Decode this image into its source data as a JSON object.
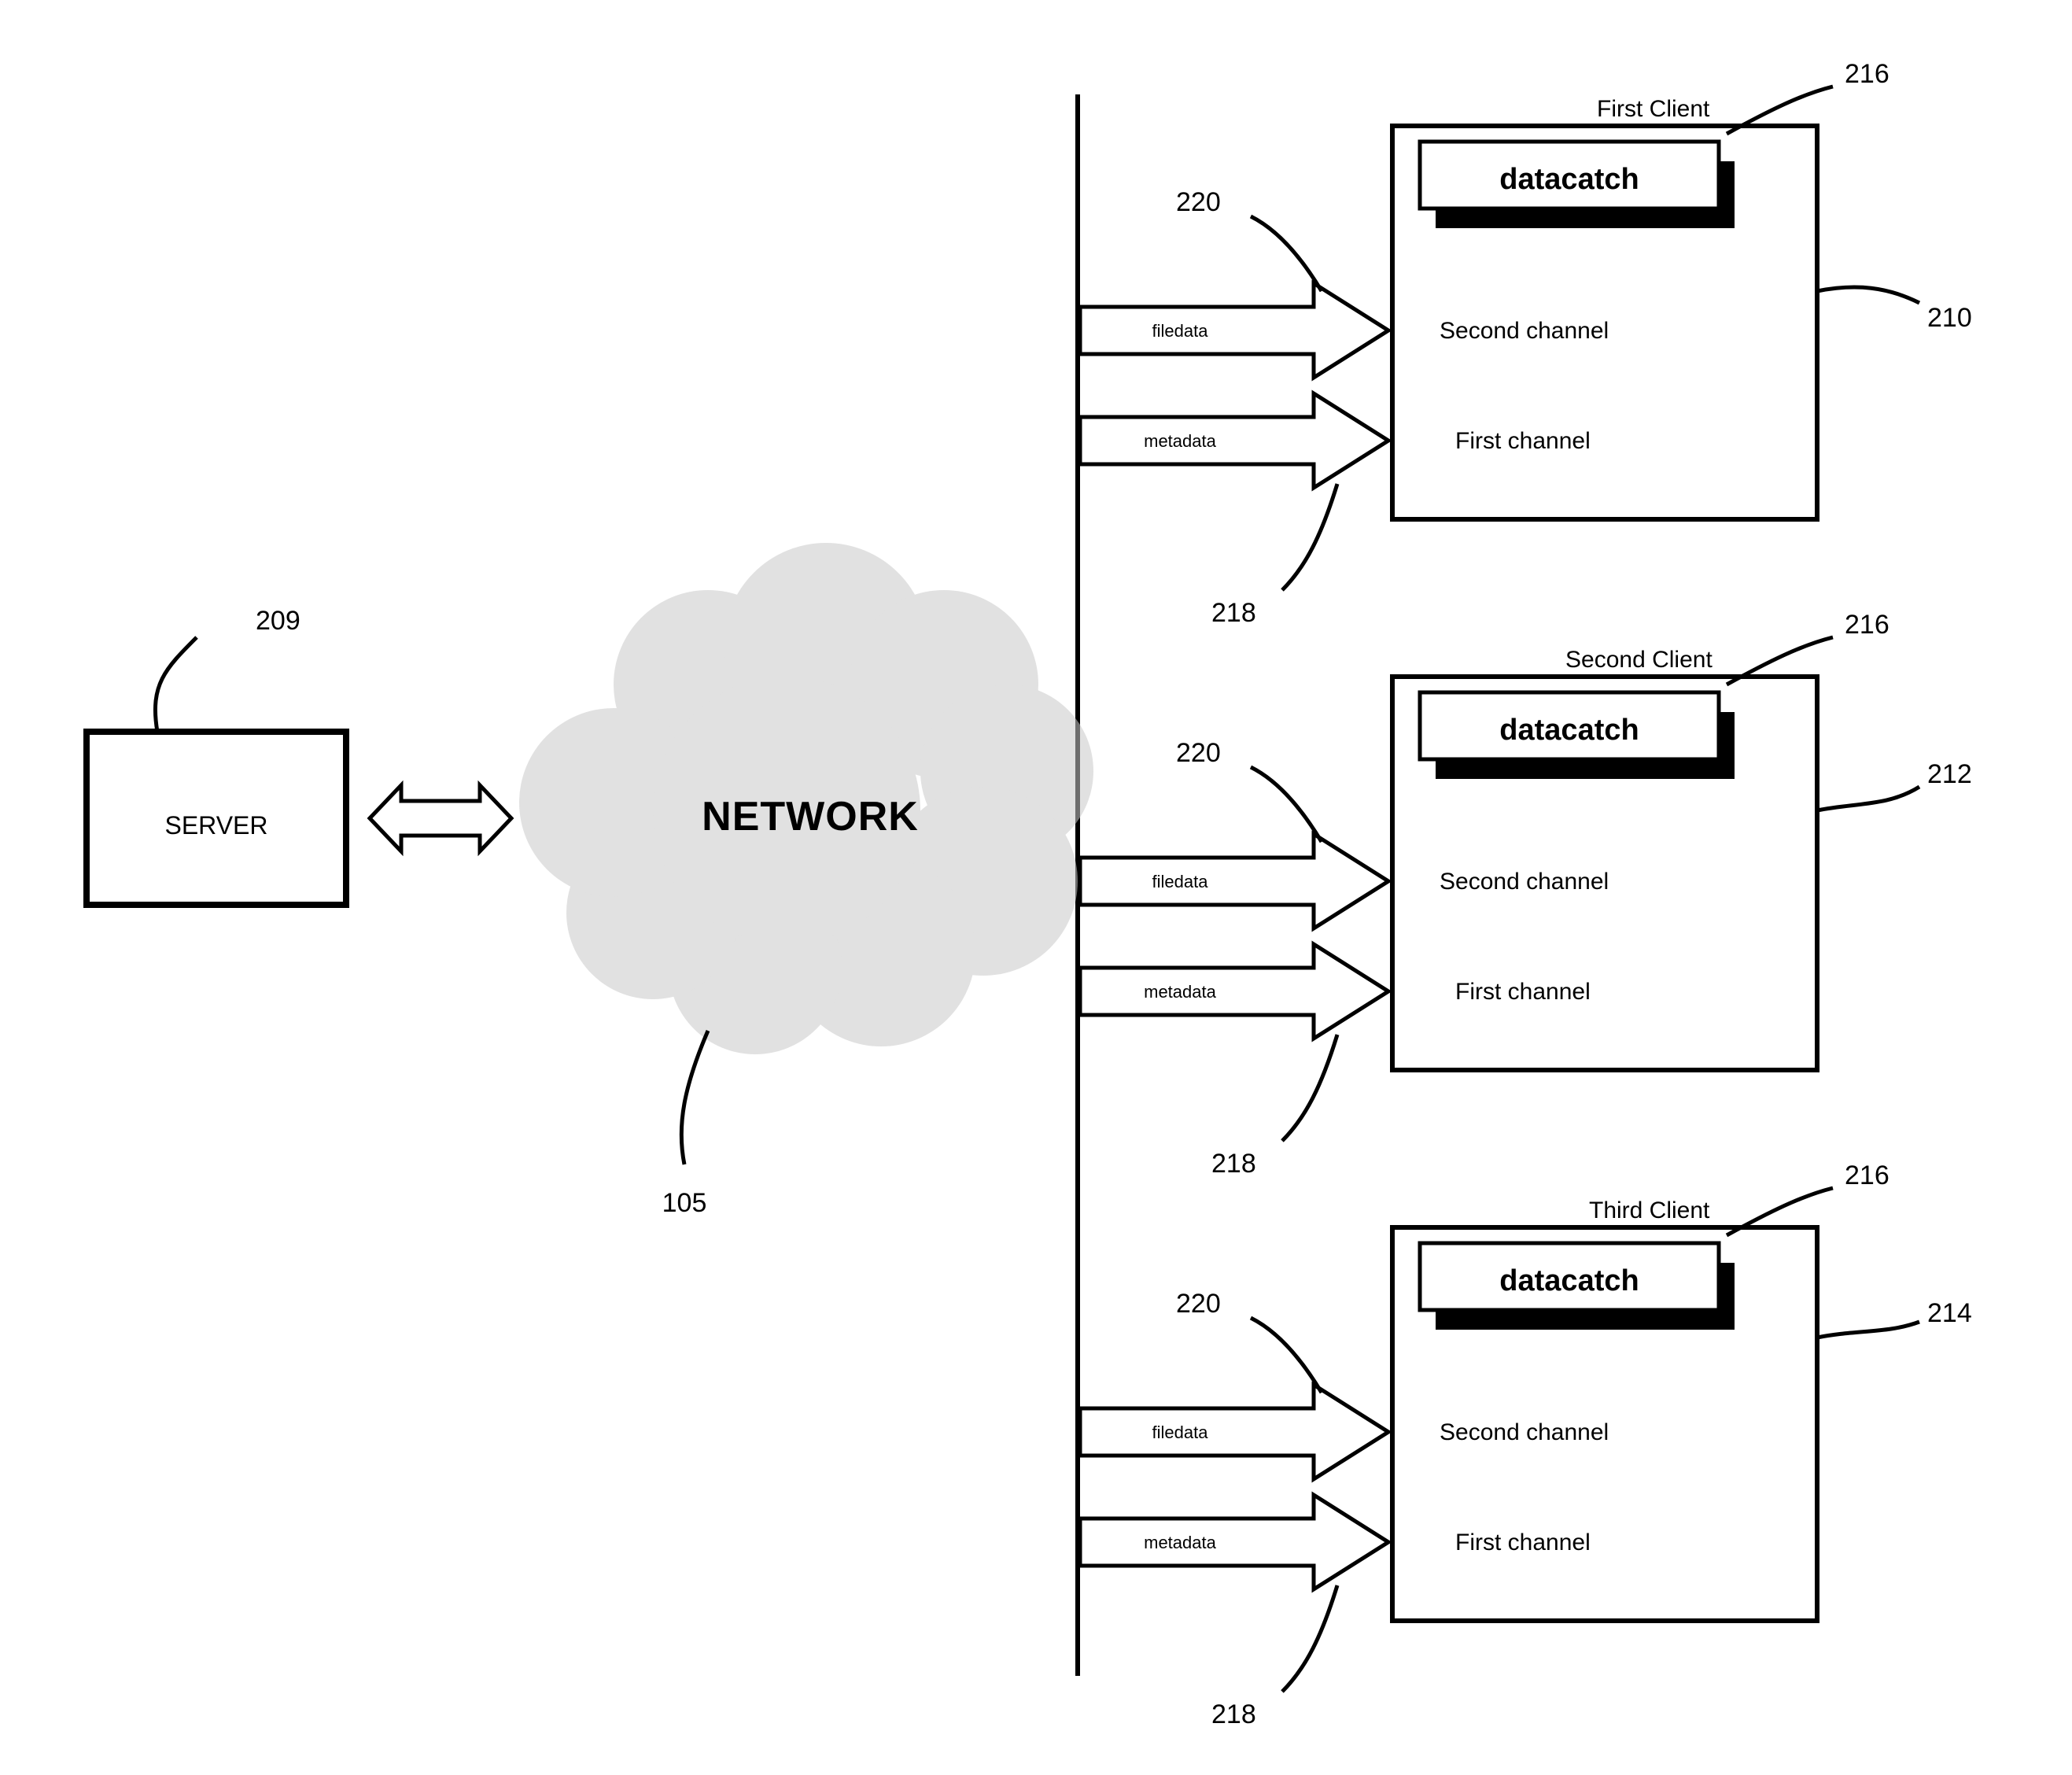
{
  "server": {
    "label": "SERVER",
    "ref": "209"
  },
  "network": {
    "label": "NETWORK",
    "ref": "105"
  },
  "clients": [
    {
      "title": "First Client",
      "datacatch_label": "datacatch",
      "datacatch_ref": "216",
      "box_ref": "210",
      "filedata_label": "filedata",
      "filedata_ref": "220",
      "second_channel": "Second channel",
      "metadata_label": "metadata",
      "metadata_ref": "218",
      "first_channel": "First channel"
    },
    {
      "title": "Second Client",
      "datacatch_label": "datacatch",
      "datacatch_ref": "216",
      "box_ref": "212",
      "filedata_label": "filedata",
      "filedata_ref": "220",
      "second_channel": "Second channel",
      "metadata_label": "metadata",
      "metadata_ref": "218",
      "first_channel": "First channel"
    },
    {
      "title": "Third Client",
      "datacatch_label": "datacatch",
      "datacatch_ref": "216",
      "box_ref": "214",
      "filedata_label": "filedata",
      "filedata_ref": "220",
      "second_channel": "Second channel",
      "metadata_label": "metadata",
      "metadata_ref": "218",
      "first_channel": "First channel"
    }
  ]
}
